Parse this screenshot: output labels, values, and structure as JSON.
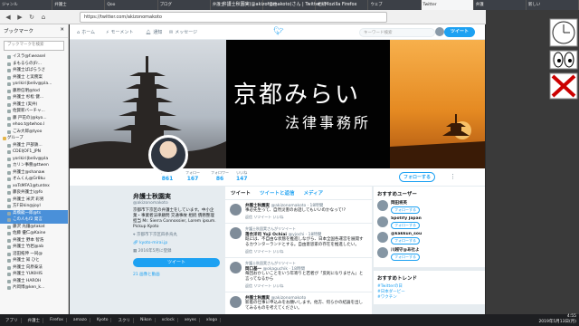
{
  "window": {
    "title": "弁護士秋園実(@akizonomakoto)さん | Twitter - Mozilla Firefox"
  },
  "browser": {
    "tabs": [
      "ジャンル",
      "弁護士",
      "Qoo",
      "ブログ",
      "弁護士",
      "「自治",
      "相続",
      "ウェブ",
      "Twitter",
      "弁護",
      "新しい"
    ],
    "url": "https://twitter.com/akizonomakoto"
  },
  "sidebar": {
    "title": "ブックマーク",
    "search_placeholder": "ブックマークを検索",
    "items": [
      {
        "label": "イスラ@f.weasel",
        "sel": false
      },
      {
        "label": "まもるらの|Fr...",
        "sel": false
      },
      {
        "label": "弁護士ばばらうさ",
        "sel": false
      },
      {
        "label": "弁護士 と実務案",
        "sel": false
      },
      {
        "label": "yorikiri|beliv@pla...",
        "sel": false
      },
      {
        "label": "藤原信明@tod",
        "sel": false
      },
      {
        "label": "弁護士 杉松 健...",
        "sel": false
      },
      {
        "label": "弁護士 (実弁)",
        "sel": false
      },
      {
        "label": "佐賀新バーチャ...",
        "sel": false
      },
      {
        "label": "藤 戸花の|@kyo...",
        "sel": false
      },
      {
        "label": "ehoo.t@twhoo.l",
        "sel": false
      },
      {
        "label": "ごみ大郎@tyoo",
        "sel": false
      },
      {
        "label": "グループ",
        "sel": false,
        "folder": true
      },
      {
        "label": "弁護士 戸部鉄...",
        "sel": false
      },
      {
        "label": "CDEI|OF1_JPN",
        "sel": false
      },
      {
        "label": "yorikiri|beliv@pla",
        "sel": false
      },
      {
        "label": "カリン事務@ttwen",
        "sel": false
      },
      {
        "label": "弁護士@shanaw",
        "sel": false
      },
      {
        "label": "オムくん@Gr8ku",
        "sel": false
      },
      {
        "label": "xxTsMFA1@tuntex",
        "sel": false
      },
      {
        "label": "藤良弁護士(@fo",
        "sel": false
      },
      {
        "label": "弁護士 米沢 彩男",
        "sel": false
      },
      {
        "label": "方F日kin@joyl",
        "sel": false
      },
      {
        "label": "高橋龍一郎@ts",
        "sel": true
      },
      {
        "label": "この人もf2 発言",
        "sel": true
      },
      {
        "label": "藤沢 光鐘@takat",
        "sel": false
      },
      {
        "label": "佐藤 優仁@Kaine",
        "sel": false
      },
      {
        "label": "弁護士 野本 智浩",
        "sel": false
      },
      {
        "label": "弁護士 竹岩@ab",
        "sel": false
      },
      {
        "label": "沼田拓伸 一同@",
        "sel": false
      },
      {
        "label": "弁護士 知 ひと",
        "sel": false
      },
      {
        "label": "弁護士 向原泰法",
        "sel": false
      },
      {
        "label": "弁護士 YUKIHIS",
        "sel": false
      },
      {
        "label": "弁護士 HAROH",
        "sel": false
      },
      {
        "label": "片岡博@ken_k...",
        "sel": false
      }
    ]
  },
  "twitter_nav": {
    "home": "ホーム",
    "moments": "モーメント",
    "notifications": "通知",
    "messages": "メッセージ",
    "search_placeholder": "キーワード検索",
    "tweet_button": "ツイート"
  },
  "header_banner": {
    "logo_main": "京都みらい",
    "logo_sub": "法律事務所"
  },
  "profile_stats": [
    {
      "label": "ツイート",
      "value": "861"
    },
    {
      "label": "フォロー",
      "value": "167"
    },
    {
      "label": "フォロワー",
      "value": "86"
    },
    {
      "label": "いいね",
      "value": "147"
    }
  ],
  "follow_button": "フォローする",
  "profile": {
    "name": "弁護士秋園実",
    "handle": "@akizonomakoto",
    "bio": "京都市下京区の弁護士をしています。中小企業・事業者法律顧問 交通事故 相続 債務整理担当 Mr. Sierra Connossier, Lorem ipsum. Pickup Kyoto",
    "location": "京都市下京区四条烏丸",
    "site": "kyoto-mirai.jp",
    "joined": "2016年5月に登録",
    "tweet_button": "ツイート",
    "photos": "21 画像と動画"
  },
  "timeline": {
    "tabs": [
      "ツイート",
      "ツイートと返信",
      "メディア"
    ],
    "tweets": [
      {
        "ctx": "",
        "name": "弁護士秋園実",
        "handle": "@akizonomakoto · 18時間",
        "text": "事必先生って、自然災害のお話してもいいのかなって!?",
        "act": "返信 リツイート いいね"
      },
      {
        "ctx": "弁護士秋園実さんがリツイート",
        "name": "落合洋司 Yoji Ochiai",
        "handle": "@yjochi · 18時間",
        "text": "既には、不自由な状態を推進しながら、日本全国各運営を展開するカウンターランドとする。自由意思家の存在を推進したい。",
        "act": "返信 リツイート いいね"
      },
      {
        "ctx": "弁護士秋園実さんがリツイート",
        "name": "岡口基一",
        "handle": "@okaguchik · 18時間",
        "text": "毎回おかしいことをいう年寄りと若者が「反則になりません」と言ってなるから",
        "act": "返信 リツイート いいね"
      },
      {
        "ctx": "",
        "name": "弁護士秋園実",
        "handle": "@akizonomakoto",
        "text": "新着の仕事に申込みをお願いします。他方、何らかの結論を出してみるものを考えてください。",
        "act": ""
      }
    ]
  },
  "who_to_follow": {
    "title": "おすすめユーザー",
    "follow": "フォローする",
    "users": [
      "岡田将英",
      "Spotify Japan",
      "@kakkun_sou",
      "川越守@あ社よ"
    ]
  },
  "trends": {
    "title": "おすすめトレンド",
    "items": [
      "#Twitterの日",
      "#日本ダービー",
      "#ワクチン"
    ]
  },
  "taskbar": {
    "items": [
      "アプリ",
      "弁護士",
      "Firefox",
      "amazo",
      "Kyoto",
      "スクリ",
      "Nikon",
      "xclock",
      "xeyes",
      "xlogo"
    ],
    "time": "4:55",
    "date": "2019年5月13日(月)"
  }
}
